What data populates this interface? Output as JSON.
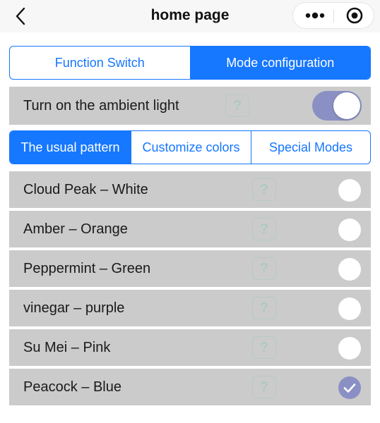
{
  "navbar": {
    "title": "home page",
    "back_icon": "chevron-left-icon",
    "more_icon": "more-dots-icon",
    "target_icon": "target-circle-icon"
  },
  "top_tabs": [
    {
      "label": "Function Switch",
      "active": false
    },
    {
      "label": "Mode configuration",
      "active": true
    }
  ],
  "ambient": {
    "label": "Turn on the ambient light",
    "help_glyph": "?",
    "enabled": true
  },
  "sub_tabs": [
    {
      "label": "The usual pattern",
      "active": true
    },
    {
      "label": "Customize colors",
      "active": false
    },
    {
      "label": "Special Modes",
      "active": false
    }
  ],
  "colors": [
    {
      "label": "Cloud Peak – White",
      "help_glyph": "?",
      "selected": false
    },
    {
      "label": "Amber – Orange",
      "help_glyph": "?",
      "selected": false
    },
    {
      "label": "Peppermint – Green",
      "help_glyph": "?",
      "selected": false
    },
    {
      "label": "vinegar – purple",
      "help_glyph": "?",
      "selected": false
    },
    {
      "label": "Su Mei – Pink",
      "help_glyph": "?",
      "selected": false
    },
    {
      "label": "Peacock – Blue",
      "help_glyph": "?",
      "selected": true
    }
  ],
  "theme": {
    "accent": "#1677ff",
    "toggle_on": "#8a90c4",
    "row_bg": "#cbcbcb"
  }
}
